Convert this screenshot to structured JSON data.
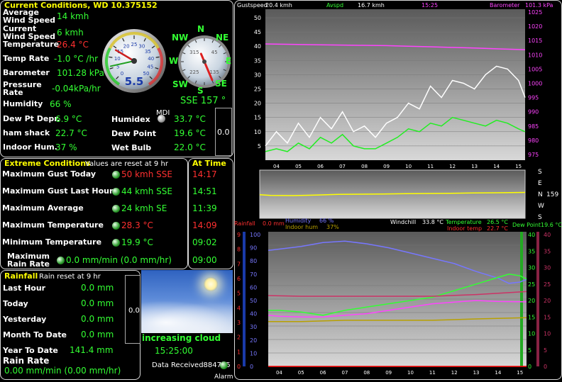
{
  "current": {
    "title": "Current Conditions, WD 10.375152",
    "rows": [
      {
        "label": "Average\nWind Speed",
        "value": "14 kmh"
      },
      {
        "label": "Current\nWind Speed",
        "value": "6 kmh"
      },
      {
        "label": "Temperature",
        "value": "26.4 °C"
      },
      {
        "label": "Temp Rate",
        "value": "-1.0 °C /hr"
      },
      {
        "label": "Barometer",
        "value": "101.28 kPa"
      },
      {
        "label": "Pressure\nRate",
        "value": "-0.04kPa/hr"
      },
      {
        "label": "Humidity",
        "value": "66 %"
      },
      {
        "label": "Dew Pt Depr.",
        "value": "6.9 °C"
      },
      {
        "label": "ham shack",
        "value": "22.7 °C"
      },
      {
        "label": "Indoor Hum.",
        "value": "37 %"
      }
    ],
    "right_rows": [
      {
        "label": "Humidex",
        "value": "33.7 °C"
      },
      {
        "label": "Dew Point",
        "value": "19.6 °C"
      },
      {
        "label": "Wet Bulb",
        "value": "22.0 °C"
      }
    ],
    "mdi_label": "MDI",
    "side_value": "0.0",
    "speed_gauge": {
      "value": "5.5",
      "needle_kmh": 6,
      "gust_kmh": 14,
      "ticks": [
        "0",
        "5",
        "10",
        "15",
        "20",
        "25",
        "30",
        "35",
        "40",
        "45",
        "50"
      ]
    },
    "compass": {
      "labels": [
        "N",
        "NE",
        "E",
        "SE",
        "S",
        "SW",
        "W",
        "NW"
      ],
      "direction_deg": 157,
      "readout": "SSE  157 °",
      "inner": [
        "315",
        "45",
        "135",
        "225"
      ]
    }
  },
  "extreme": {
    "title": "Extreme Conditions",
    "subtitle": "Values are reset at 9 hr",
    "at_time_title": "At Time",
    "rows": [
      {
        "label": "Maximum Gust Today",
        "value": "50 kmh SSE",
        "time": "14:17",
        "red": true
      },
      {
        "label": "Maximum Gust Last Hour",
        "value": "44 kmh SSE",
        "time": "14:51",
        "red": false
      },
      {
        "label": "Maximum Average",
        "value": "24 kmh  SE",
        "time": "11:39",
        "red": false
      },
      {
        "label": "Maximum Temperature",
        "value": "28.3 °C",
        "time": "14:09",
        "red": true
      },
      {
        "label": "Minimum Temperature",
        "value": "19.9 °C",
        "time": "09:02",
        "red": false
      },
      {
        "label": "Maximum\nRain Rate",
        "value": "0.0 mm/min (0.0 mm/hr)",
        "time": "09:00",
        "red": false
      }
    ]
  },
  "rainfall": {
    "title": "Rainfall",
    "subtitle": "Rain reset at 9 hr",
    "rows": [
      {
        "label": "Last Hour",
        "value": "0.0 mm"
      },
      {
        "label": "Today",
        "value": "0.0 mm"
      },
      {
        "label": "Yesterday",
        "value": "0.0 mm"
      },
      {
        "label": "Month To Date",
        "value": "0.0 mm"
      },
      {
        "label": "Year To Date",
        "value": "141.4 mm"
      }
    ],
    "rate_label": "Rain Rate",
    "rate_value": "0.00 mm/min (0.00 mm/hr)",
    "side_value": "0.0"
  },
  "forecast": {
    "text": "increasing cloud",
    "time": "15:25:00"
  },
  "status": {
    "data_received": "Data Received884735",
    "alarm": "Alarm"
  },
  "colors": {
    "green": "#33ff33",
    "red": "#ff3030",
    "yellow": "#ffff00",
    "magenta": "#ff44ff"
  },
  "chart_data": [
    {
      "type": "line",
      "legend": [
        "Gustspeed",
        "20.4 kmh",
        "Avspd",
        "16.7 kmh",
        "15:25",
        "Barometer",
        "101.3 kPa"
      ],
      "x_ticks": [
        "04",
        "05",
        "06",
        "07",
        "08",
        "09",
        "10",
        "11",
        "12",
        "13",
        "14",
        "15"
      ],
      "y_left": [
        "50",
        "45",
        "40",
        "35",
        "30",
        "25",
        "20",
        "15",
        "10",
        "5"
      ],
      "y_right": [
        "1025",
        "1020",
        "1015",
        "1010",
        "1005",
        "1000",
        "995",
        "990",
        "985",
        "980",
        "975"
      ],
      "ylim": [
        0,
        50
      ],
      "ylim_right": [
        975,
        1025
      ],
      "series": [
        {
          "name": "Barometer",
          "color": "#ff44ff",
          "axis": "right",
          "x": [
            3.5,
            5,
            6,
            7,
            8,
            9,
            10,
            11,
            12,
            13,
            14,
            15.3
          ],
          "values": [
            1013.8,
            1013.6,
            1013.5,
            1013.4,
            1013.3,
            1013.2,
            1013,
            1012.8,
            1012.6,
            1012.4,
            1012.1,
            1011.8
          ]
        },
        {
          "name": "Gustspeed",
          "color": "#ffffff",
          "x": [
            3.5,
            4,
            4.5,
            5,
            5.5,
            6,
            6.5,
            7,
            7.5,
            8,
            8.5,
            9,
            9.5,
            10,
            10.5,
            11,
            11.5,
            12,
            12.5,
            13,
            13.5,
            14,
            14.5,
            15,
            15.3
          ],
          "values": [
            5,
            10,
            6,
            13,
            8,
            15,
            11,
            17,
            10,
            12,
            8,
            13,
            15,
            20,
            18,
            26,
            22,
            28,
            27,
            25,
            30,
            33,
            32,
            28,
            22
          ]
        },
        {
          "name": "Avspd",
          "color": "#22ee22",
          "x": [
            3.5,
            4,
            4.5,
            5,
            5.5,
            6,
            6.5,
            7,
            7.5,
            8,
            8.5,
            9,
            9.5,
            10,
            10.5,
            11,
            11.5,
            12,
            12.5,
            13,
            13.5,
            14,
            14.5,
            15,
            15.3
          ],
          "values": [
            3,
            4,
            3,
            6,
            4,
            8,
            6,
            9,
            5,
            4,
            4,
            6,
            8,
            11,
            10,
            13,
            12,
            15,
            14,
            13,
            12,
            14,
            13,
            11,
            10
          ]
        }
      ]
    },
    {
      "type": "line",
      "y_right": [
        "S",
        "E",
        "N",
        "W",
        "S"
      ],
      "readout": "159",
      "series": [
        {
          "name": "Wind direction",
          "color": "#ffff00",
          "x": [
            3.5,
            4,
            5,
            6,
            7,
            8,
            9,
            10,
            11,
            12,
            13,
            14,
            15.3
          ],
          "values": [
            175,
            170,
            168,
            172,
            178,
            180,
            182,
            184,
            186,
            188,
            190,
            192,
            195
          ]
        }
      ]
    },
    {
      "type": "line",
      "legend": [
        "Rainfall",
        "0.0 mm",
        "Humidity",
        "66 %",
        "Indoor hum",
        "37%",
        "Windchill",
        "33.8 °C",
        "Temperature",
        "26.5 °C",
        "Indoor temp",
        "22.7 °C",
        "Dew Point",
        "19.6 °C"
      ],
      "x_ticks": [
        "04",
        "05",
        "06",
        "07",
        "08",
        "09",
        "10",
        "11",
        "12",
        "13",
        "14",
        "15"
      ],
      "y_left_rain": [
        "9",
        "8",
        "7",
        "6",
        "5",
        "4",
        "3",
        "2",
        "1",
        "0"
      ],
      "y_left_hum": [
        "100",
        "90",
        "80",
        "70",
        "60",
        "50",
        "40",
        "30",
        "20",
        "10",
        "0"
      ],
      "y_right_temp_green": [
        "40",
        "35",
        "30",
        "25",
        "20",
        "15",
        "10",
        "5",
        "0"
      ],
      "y_right_temp_red": [
        "40",
        "35",
        "30",
        "25",
        "20",
        "15",
        "10",
        "5",
        "0"
      ],
      "ylim": [
        0,
        40
      ],
      "series": [
        {
          "name": "Humidity",
          "color": "#7777ff",
          "axis": "left_hum",
          "x": [
            3.5,
            4,
            5,
            6,
            7,
            8,
            9,
            10,
            11,
            12,
            13,
            14,
            14.5,
            15,
            15.3
          ],
          "values": [
            88,
            89,
            91,
            94,
            95,
            93,
            90,
            86,
            82,
            78,
            72,
            67,
            63,
            64,
            66
          ]
        },
        {
          "name": "Temperature",
          "color": "#33ff33",
          "axis": "right",
          "x": [
            3.5,
            4,
            5,
            6,
            7,
            8,
            9,
            10,
            11,
            12,
            13,
            14,
            14.5,
            15,
            15.3
          ],
          "values": [
            17,
            17,
            16.5,
            15.5,
            17,
            18,
            19,
            20,
            21,
            23,
            25,
            27,
            28,
            27.5,
            26.5
          ]
        },
        {
          "name": "Indoor temp",
          "color": "#cc3366",
          "axis": "right",
          "x": [
            3.5,
            5,
            7,
            9,
            11,
            13,
            15.3
          ],
          "values": [
            21.5,
            21.3,
            21.3,
            21.3,
            21.3,
            21.8,
            22.7
          ]
        },
        {
          "name": "Dew Point",
          "color": "#ff44ff",
          "axis": "right",
          "x": [
            3.5,
            4,
            5,
            6,
            7,
            8,
            9,
            10,
            11,
            12,
            13,
            14,
            15.3
          ],
          "values": [
            15.5,
            15.2,
            15,
            15,
            15.5,
            16,
            17,
            18,
            19,
            19.5,
            20,
            19.7,
            19.6
          ]
        },
        {
          "name": "Indoor hum",
          "color": "#b8a000",
          "axis": "left_hum",
          "x": [
            3.5,
            5,
            7,
            9,
            11,
            13,
            15.3
          ],
          "values": [
            34,
            34,
            35,
            35,
            35,
            36,
            37
          ]
        },
        {
          "name": "Rainfall",
          "color": "#ff0000",
          "axis": "left_rain",
          "x": [
            3.5,
            15.3
          ],
          "values": [
            0,
            0
          ]
        }
      ]
    }
  ]
}
